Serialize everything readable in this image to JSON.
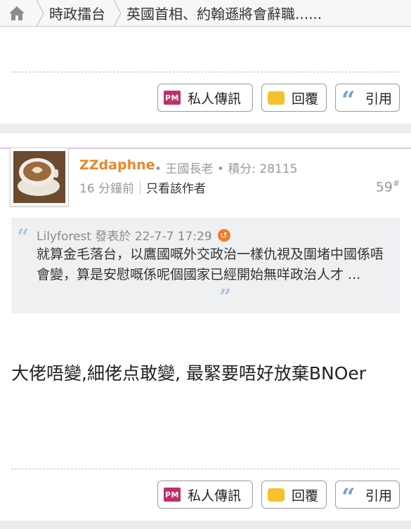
{
  "breadcrumb": {
    "forum": "時政擂台",
    "thread": "英國首相、約翰遜將會辭職......"
  },
  "actions": {
    "pm_icon_text": "PM",
    "pm_label": "私人傳訊",
    "reply_label": "回覆",
    "quote_label": "引用"
  },
  "post": {
    "author": "ZZdaphne",
    "rank": "• 王國長老 • 積分: 28115",
    "time": "16 分鐘前",
    "only_author": "只看該作者",
    "floor": "59",
    "floor_mark": "#",
    "quote": {
      "author_line": "Lilyforest 發表於 22-7-7 17:29",
      "text": "就算金毛落台，以鷹國嘅外交政治一樣仇視及圍堵中國係唔會變，算是安慰嘅係呢個國家已經開始無咩政治人才 ..."
    },
    "body": "大佬唔變,細佬点敢變, 最緊要唔好放棄BNOer"
  },
  "icons": {
    "home": "home-icon",
    "pm": "pm-icon",
    "reply": "reply-bubble-icon",
    "quote": "quote-icon"
  },
  "colors": {
    "author": "#e8872b",
    "pm": "#c0306a",
    "reply": "#f5c22c",
    "quote": "#6fa3d6"
  }
}
